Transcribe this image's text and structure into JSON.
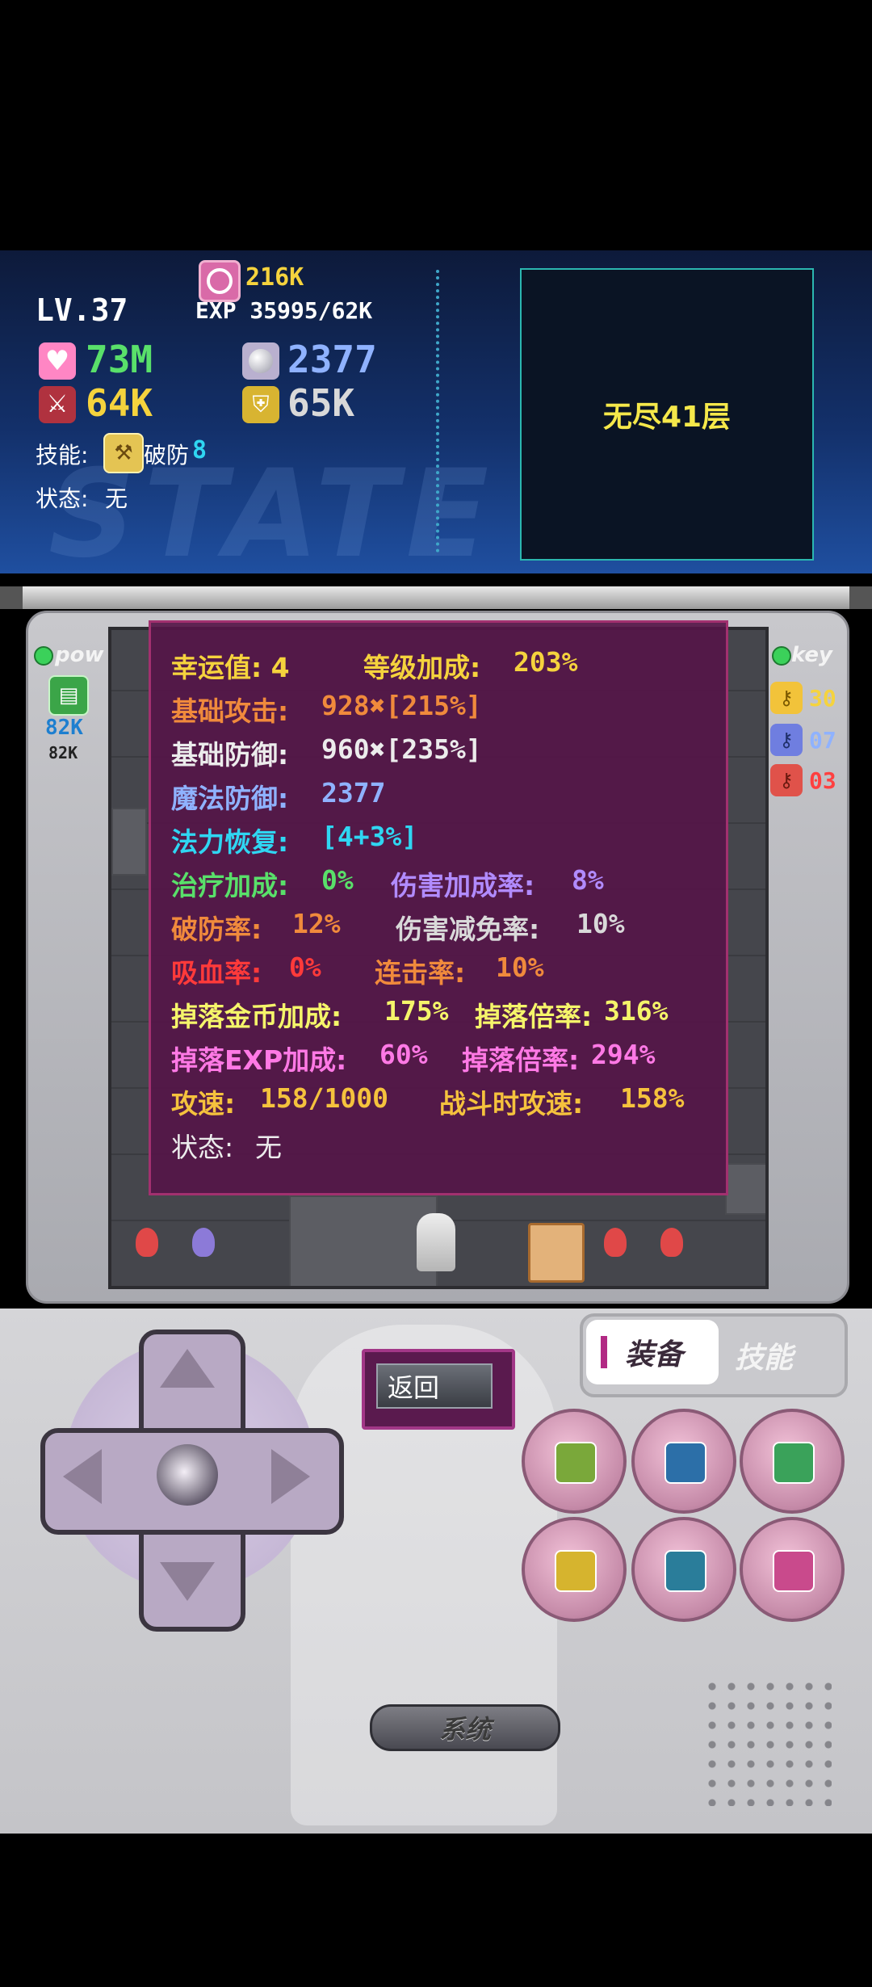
{
  "player": {
    "level": "LV.37",
    "gold": "216K",
    "exp": "EXP 35995/62K",
    "hp": "73M",
    "mdef": "2377",
    "atk": "64K",
    "def": "65K",
    "skill_label": "技能:",
    "skill_name": "破防",
    "skill_level": "8",
    "state_label": "状态:",
    "state_value": "无",
    "watermark": "STATE"
  },
  "floor": {
    "label": "无尽41层"
  },
  "left_side": {
    "pow_label": "pow",
    "book_value": "82K",
    "book_value2": "82K"
  },
  "right_side": {
    "key_label": "key",
    "keys": [
      {
        "color": "#f2c33a",
        "count": "30"
      },
      {
        "color": "#6f7ee0",
        "count": "07"
      },
      {
        "color": "#e0524a",
        "count": "03"
      }
    ]
  },
  "stats": {
    "luck": "幸运值: 4",
    "level_bonus_label": "等级加成:",
    "level_bonus": "203%",
    "base_atk_label": "基础攻击:",
    "base_atk": "928✖[215%]",
    "base_def_label": "基础防御:",
    "base_def": "960✖[235%]",
    "mdef_label": "魔法防御:",
    "mdef": "2377",
    "mana_label": "法力恢复:",
    "mana": "[4+3%]",
    "heal_label": "治疗加成:",
    "heal": "0%",
    "dmg_bonus_label": "伤害加成率:",
    "dmg_bonus": "8%",
    "break_label": "破防率:",
    "break": "12%",
    "dmg_reduce_label": "伤害减免率:",
    "dmg_reduce": "10%",
    "lifesteal_label": "吸血率:",
    "lifesteal": "0%",
    "combo_label": "连击率:",
    "combo": "10%",
    "gold_drop_label": "掉落金币加成:",
    "gold_drop": "175%",
    "gold_mult_label": "掉落倍率:",
    "gold_mult": "316%",
    "exp_drop_label": "掉落EXP加成:",
    "exp_drop": "60%",
    "exp_mult_label": "掉落倍率:",
    "exp_mult": "294%",
    "speed_label": "攻速:",
    "speed": "158/1000",
    "battle_speed_label": "战斗时攻速:",
    "battle_speed": "158%",
    "state_label": "状态:",
    "state": "无"
  },
  "controls": {
    "back_label": "返回",
    "tab_equip": "装备",
    "tab_skill": "技能",
    "system_label": "系统"
  },
  "colors": {
    "gold": "#f5d33d",
    "orange": "#f08a3c",
    "red": "#ff3a3a",
    "cyan": "#2fd6f2",
    "green": "#59e06a",
    "purple": "#b18bff",
    "blue": "#8fb2ff",
    "pink": "#ff79e5"
  }
}
